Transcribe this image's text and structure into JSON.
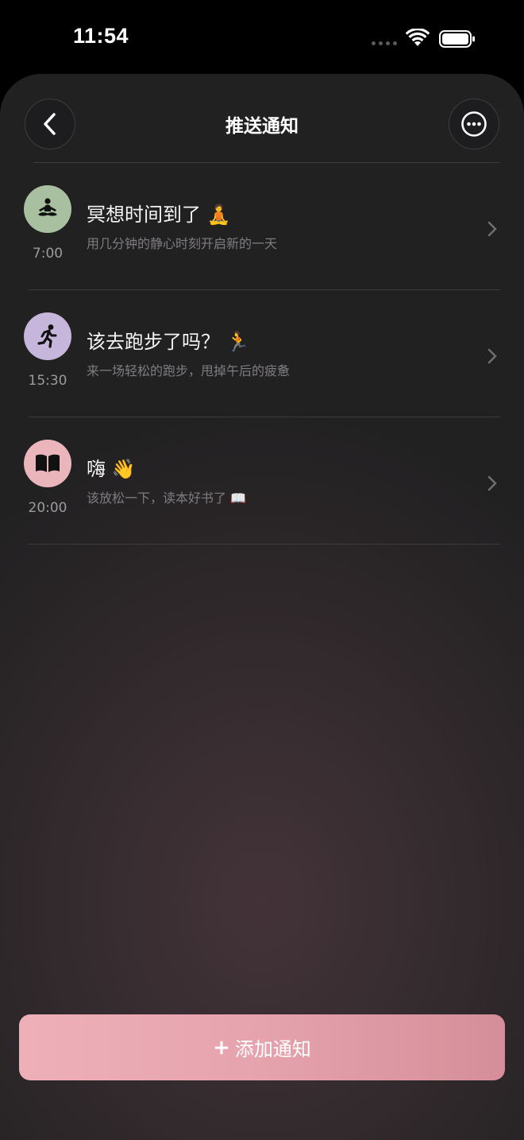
{
  "status_bar": {
    "time": "11:54"
  },
  "header": {
    "title": "推送通知",
    "back_icon": "chevron-left-icon",
    "more_icon": "ellipsis-circle-icon"
  },
  "notifications": [
    {
      "icon": "meditation-icon",
      "icon_bg": "#a9c0a0",
      "time": "7:00",
      "title": "冥想时间到了 🧘",
      "subtitle": "用几分钟的静心时刻开启新的一天"
    },
    {
      "icon": "running-icon",
      "icon_bg": "#c6b6dc",
      "time": "15:30",
      "title": "该去跑步了吗？ 🏃",
      "subtitle": "来一场轻松的跑步，甩掉午后的疲惫"
    },
    {
      "icon": "book-icon",
      "icon_bg": "#eab5bb",
      "time": "20:00",
      "title": "嗨 👋",
      "subtitle": "该放松一下，读本好书了 📖"
    }
  ],
  "add_button": {
    "plus": "+",
    "label": "添加通知"
  },
  "colors": {
    "accent_pink": "#e5a3ad",
    "background": "#222122"
  }
}
